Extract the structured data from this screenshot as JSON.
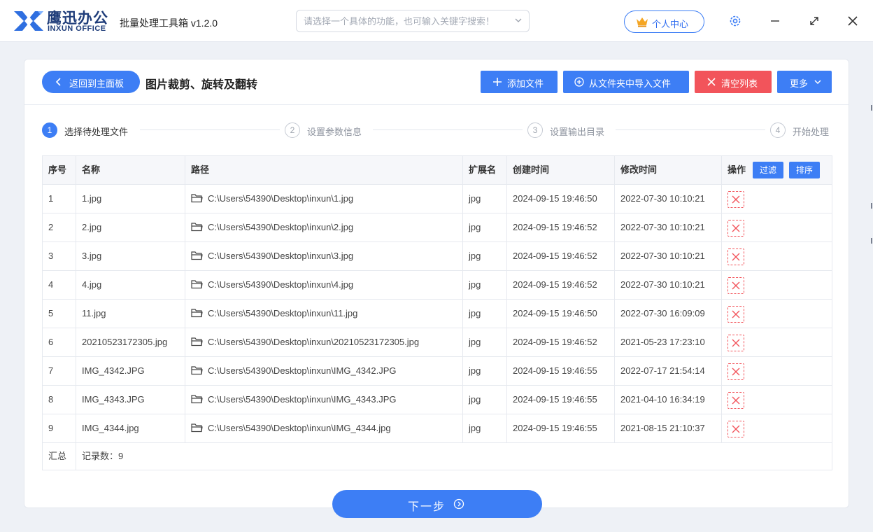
{
  "titlebar": {
    "brand_cn": "鹰迅办公",
    "brand_en": "INXUN OFFICE",
    "app_title": "批量处理工具箱 v1.2.0",
    "search_placeholder": "请选择一个具体的功能，也可输入关键字搜索！",
    "user_center": "个人中心",
    "colors": {
      "brand": "#1f3d7a",
      "accent": "#3d7ef5",
      "danger": "#f2545b"
    }
  },
  "toolbar": {
    "back_label": "返回到主面板",
    "page_title": "图片裁剪、旋转及翻转",
    "add_file": "添加文件",
    "import_folder": "从文件夹中导入文件",
    "clear_list": "清空列表",
    "more": "更多"
  },
  "steps": [
    {
      "num": "1",
      "label": "选择待处理文件",
      "active": true
    },
    {
      "num": "2",
      "label": "设置参数信息",
      "active": false
    },
    {
      "num": "3",
      "label": "设置输出目录",
      "active": false
    },
    {
      "num": "4",
      "label": "开始处理",
      "active": false
    }
  ],
  "table": {
    "headers": {
      "no": "序号",
      "name": "名称",
      "path": "路径",
      "ext": "扩展名",
      "ctime": "创建时间",
      "mtime": "修改时间",
      "op": "操作",
      "filter": "过滤",
      "sort": "排序"
    },
    "rows": [
      {
        "no": "1",
        "name": "1.jpg",
        "path": "C:\\Users\\54390\\Desktop\\inxun\\1.jpg",
        "ext": "jpg",
        "ctime": "2024-09-15 19:46:50",
        "mtime": "2022-07-30 10:10:21"
      },
      {
        "no": "2",
        "name": "2.jpg",
        "path": "C:\\Users\\54390\\Desktop\\inxun\\2.jpg",
        "ext": "jpg",
        "ctime": "2024-09-15 19:46:52",
        "mtime": "2022-07-30 10:10:21"
      },
      {
        "no": "3",
        "name": "3.jpg",
        "path": "C:\\Users\\54390\\Desktop\\inxun\\3.jpg",
        "ext": "jpg",
        "ctime": "2024-09-15 19:46:52",
        "mtime": "2022-07-30 10:10:21"
      },
      {
        "no": "4",
        "name": "4.jpg",
        "path": "C:\\Users\\54390\\Desktop\\inxun\\4.jpg",
        "ext": "jpg",
        "ctime": "2024-09-15 19:46:52",
        "mtime": "2022-07-30 10:10:21"
      },
      {
        "no": "5",
        "name": "11.jpg",
        "path": "C:\\Users\\54390\\Desktop\\inxun\\11.jpg",
        "ext": "jpg",
        "ctime": "2024-09-15 19:46:50",
        "mtime": "2022-07-30 16:09:09"
      },
      {
        "no": "6",
        "name": "20210523172305.jpg",
        "path": "C:\\Users\\54390\\Desktop\\inxun\\20210523172305.jpg",
        "ext": "jpg",
        "ctime": "2024-09-15 19:46:52",
        "mtime": "2021-05-23 17:23:10"
      },
      {
        "no": "7",
        "name": "IMG_4342.JPG",
        "path": "C:\\Users\\54390\\Desktop\\inxun\\IMG_4342.JPG",
        "ext": "jpg",
        "ctime": "2024-09-15 19:46:55",
        "mtime": "2022-07-17 21:54:14"
      },
      {
        "no": "8",
        "name": "IMG_4343.JPG",
        "path": "C:\\Users\\54390\\Desktop\\inxun\\IMG_4343.JPG",
        "ext": "jpg",
        "ctime": "2024-09-15 19:46:55",
        "mtime": "2021-04-10 16:34:19"
      },
      {
        "no": "9",
        "name": "IMG_4344.jpg",
        "path": "C:\\Users\\54390\\Desktop\\inxun\\IMG_4344.jpg",
        "ext": "jpg",
        "ctime": "2024-09-15 19:46:55",
        "mtime": "2021-08-15 21:10:37"
      }
    ],
    "summary_label": "汇总",
    "record_count": "记录数：9"
  },
  "footer": {
    "next_label": "下一步"
  }
}
